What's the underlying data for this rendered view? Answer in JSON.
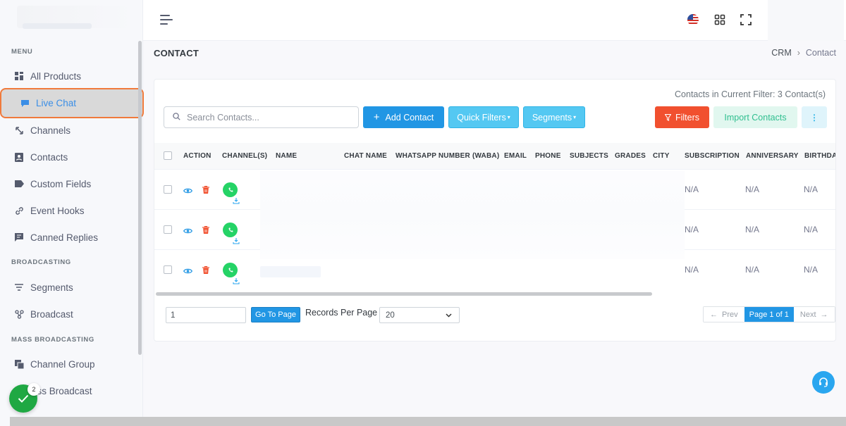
{
  "sidebar": {
    "sections": [
      "MENU",
      "BROADCASTING",
      "MASS BROADCASTING"
    ],
    "items": [
      {
        "label": "All Products"
      },
      {
        "label": "Live Chat"
      },
      {
        "label": "Channels"
      },
      {
        "label": "Contacts"
      },
      {
        "label": "Custom Fields"
      },
      {
        "label": "Event Hooks"
      },
      {
        "label": "Canned Replies"
      },
      {
        "label": "Segments"
      },
      {
        "label": "Broadcast"
      },
      {
        "label": "Channel Group"
      },
      {
        "label": "ass Broadcast"
      }
    ]
  },
  "page": {
    "title": "CONTACT",
    "breadcrumb": [
      "CRM",
      "Contact"
    ]
  },
  "toolbar": {
    "filter_count": "Contacts in Current Filter: 3 Contact(s)",
    "search_placeholder": "Search Contacts...",
    "add_contact": "Add Contact",
    "quick_filters": "Quick Filters",
    "segments": "Segments",
    "filters": "Filters",
    "import_contacts": "Import Contacts"
  },
  "table": {
    "headers": [
      "ACTION",
      "CHANNEL(S)",
      "NAME",
      "CHAT NAME",
      "WHATSAPP NUMBER (WABA)",
      "EMAIL",
      "PHONE",
      "SUBJECTS",
      "GRADES",
      "CITY",
      "SUBSCRIPTION",
      "ANNIVERSARY",
      "BIRTHDAY"
    ],
    "rows": [
      {
        "subscription": "N/A",
        "anniversary": "N/A",
        "birthday": "N/A"
      },
      {
        "subscription": "N/A",
        "anniversary": "N/A",
        "birthday": "N/A"
      },
      {
        "subscription": "N/A",
        "anniversary": "N/A",
        "birthday": "N/A"
      }
    ]
  },
  "pagination": {
    "page_input": "1",
    "goto_label": "Go To Page",
    "records_label": "Records Per Page",
    "records_value": "20",
    "prev": "Prev",
    "current": "Page 1 of 1",
    "next": "Next"
  },
  "notifications": {
    "badge_count": "2"
  },
  "colors": {
    "primary": "#2196e4",
    "info": "#54c8f2",
    "danger": "#f1502f",
    "success": "#25d366",
    "active_border": "#f07a3b"
  }
}
